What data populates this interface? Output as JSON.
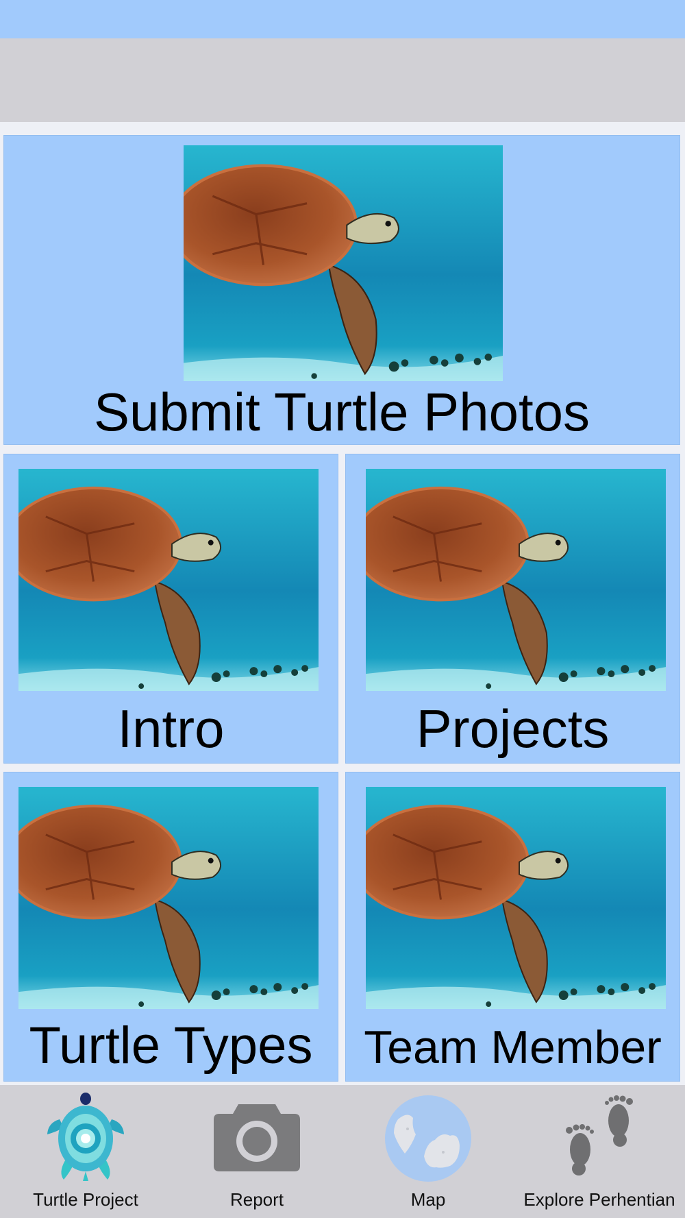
{
  "tiles": {
    "submit": {
      "label": "Submit Turtle Photos"
    },
    "intro": {
      "label": "Intro"
    },
    "projects": {
      "label": "Projects"
    },
    "turtle_types": {
      "label": "Turtle Types"
    },
    "team_member": {
      "label": "Team Member"
    }
  },
  "tabs": [
    {
      "label": "Turtle Project",
      "icon": "turtle-logo-icon"
    },
    {
      "label": "Report",
      "icon": "camera-icon"
    },
    {
      "label": "Map",
      "icon": "globe-map-icon"
    },
    {
      "label": "Explore Perhentian",
      "icon": "footprints-icon"
    }
  ],
  "colors": {
    "accent": "#a1cafc",
    "bar_gray": "#d1d0d5",
    "icon_gray": "#7b7b7d"
  }
}
